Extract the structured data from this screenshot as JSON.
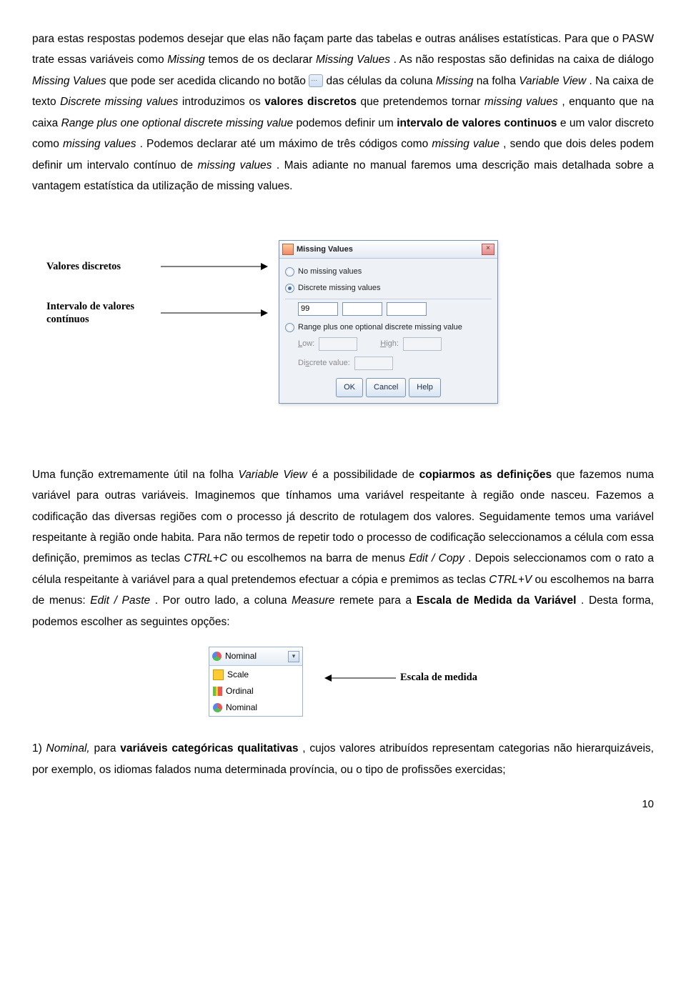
{
  "para1_parts": {
    "t1": "para estas respostas podemos desejar que elas não façam parte das tabelas e outras análises estatísticas. Para que o PASW trate essas variáveis como ",
    "i1": "Missing",
    "t2": " temos de os declarar ",
    "i2": "Missing Values",
    "t3": ". As não respostas são definidas na caixa de diálogo ",
    "i3": "Missing Values",
    "t4": " que pode ser acedida clicando no botão ",
    "t5": " das células da coluna ",
    "i4": "Missing",
    "t6": " na folha ",
    "i5": "Variable View",
    "t7": ". Na caixa de texto ",
    "i6": "Discrete missing values",
    "t8": " introduzimos os ",
    "b1": "valores discretos",
    "t9": " que pretendemos tornar ",
    "i7": "missing values",
    "t10": ", enquanto que na caixa ",
    "i8": "Range plus one optional discrete missing value",
    "t11": " podemos definir um ",
    "b2": "intervalo de valores continuos",
    "t12": " e um valor discreto como ",
    "i9": "missing values",
    "t13": ". Podemos declarar até um máximo de três códigos como ",
    "i10": "missing value",
    "t14": ", sendo que dois deles podem definir um intervalo contínuo de ",
    "i11": "missing values",
    "t15": ". Mais adiante no manual faremos uma descrição mais detalhada sobre a vantagem estatística da utilização de missing values."
  },
  "annot": {
    "valores_discretos": "Valores discretos",
    "intervalo": "Intervalo de valores contínuos",
    "escala": "Escala de medida"
  },
  "dialog": {
    "title": "Missing Values",
    "no_missing": "No missing values",
    "discrete": "Discrete missing values",
    "val": "99",
    "range": "Range plus one optional discrete missing value",
    "low": "Low:",
    "high": "High:",
    "discrete_value": "Discrete value:",
    "ok": "OK",
    "cancel": "Cancel",
    "help": "Help"
  },
  "para2_parts": {
    "t1": "Uma função extremamente útil na folha ",
    "i1": "Variable View",
    "t2": " é a possibilidade de ",
    "b1": "copiarmos as definições",
    "t3": " que fazemos numa variável para outras variáveis. Imaginemos que tínhamos uma variável respeitante à região onde nasceu. Fazemos a codificação das diversas regiões com o processo já descrito de rotulagem dos valores. Seguidamente temos uma variável respeitante à região onde habita. Para não termos de repetir todo o processo de codificação seleccionamos a célula com essa definição, premimos as teclas ",
    "i2": "CTRL+C",
    "t4": " ou escolhemos na barra de menus ",
    "i3": "Edit / Copy",
    "t5": ". Depois seleccionamos com o rato a célula respeitante à variável para a qual pretendemos efectuar a cópia e premimos as teclas ",
    "i4": "CTRL+V",
    "t6": " ou escolhemos na barra de menus: ",
    "i5": "Edit / Paste",
    "t7": ". Por outro lado, a coluna ",
    "i6": "Measure",
    "t8": " remete para a ",
    "b2": "Escala de Medida da Variável",
    "t9": ". Desta forma, podemos escolher as seguintes opções:"
  },
  "measure": {
    "sel": "Nominal",
    "opt1": "Scale",
    "opt2": "Ordinal",
    "opt3": "Nominal"
  },
  "para3_parts": {
    "t1": "1) ",
    "i1": "Nominal,",
    "t2": " para ",
    "b1": "variáveis categóricas qualitativas",
    "t3": ", cujos valores atribuídos representam categorias não hierarquizáveis, por exemplo, os idiomas falados numa determinada província, ou o tipo de profissões exercidas;"
  },
  "page_num": "10"
}
